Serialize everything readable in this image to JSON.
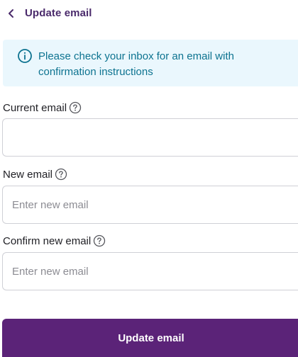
{
  "header": {
    "back_icon": "chevron-left-icon",
    "title": "Update email"
  },
  "info_banner": {
    "icon": "info-icon",
    "message": "Please check your inbox for an email with confirmation instructions"
  },
  "form": {
    "current_email": {
      "label": "Current email",
      "value": "",
      "placeholder": ""
    },
    "new_email": {
      "label": "New email",
      "value": "",
      "placeholder": "Enter new email"
    },
    "confirm_email": {
      "label": "Confirm new email",
      "value": "",
      "placeholder": "Enter new email"
    },
    "help_icon": "question-circle-icon"
  },
  "submit": {
    "label": "Update email"
  },
  "colors": {
    "brand": "#5b2378",
    "header_text": "#4a2a6b",
    "info_bg": "#eaf7fd",
    "info_text": "#0d7390",
    "border": "#cfd0d6"
  }
}
